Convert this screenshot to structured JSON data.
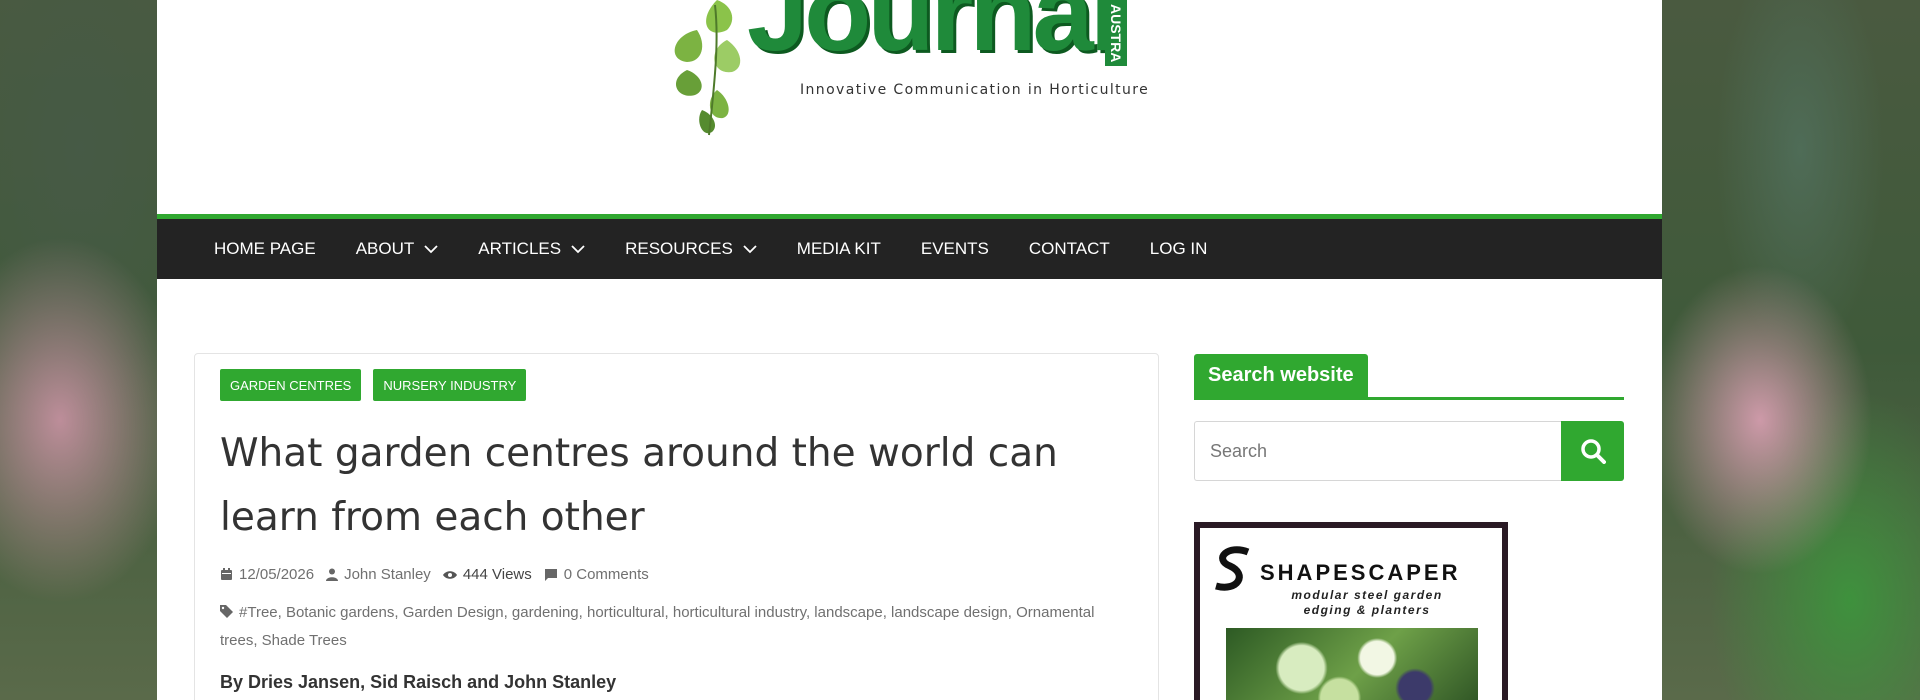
{
  "logo": {
    "word": "Journal",
    "badge": "AUSTRA",
    "tagline": "Innovative Communication in Horticulture"
  },
  "nav": {
    "items": [
      {
        "label": "HOME PAGE",
        "dropdown": false
      },
      {
        "label": "ABOUT",
        "dropdown": true
      },
      {
        "label": "ARTICLES",
        "dropdown": true
      },
      {
        "label": "RESOURCES",
        "dropdown": true
      },
      {
        "label": "MEDIA KIT",
        "dropdown": false
      },
      {
        "label": "EVENTS",
        "dropdown": false
      },
      {
        "label": "CONTACT",
        "dropdown": false
      },
      {
        "label": "LOG IN",
        "dropdown": false
      }
    ]
  },
  "article": {
    "categories": [
      "GARDEN CENTRES",
      "NURSERY INDUSTRY"
    ],
    "title": "What garden centres around the world can learn from each other",
    "date": "12/05/2026",
    "author": "John Stanley",
    "views": "444 Views",
    "comments": "0 Comments",
    "tags": "#Tree, Botanic gardens, Garden Design, gardening, horticultural, horticultural industry, landscape, landscape design, Ornamental trees, Shade Trees",
    "byline": "By Dries Jansen, Sid Raisch and John Stanley"
  },
  "sidebar": {
    "search_title": "Search website",
    "search_placeholder": "Search",
    "ad": {
      "brand": "SHAPESCAPER",
      "line1": "modular steel garden",
      "line2": "edging & planters"
    }
  },
  "colors": {
    "accent": "#30a830",
    "nav_bg": "#232323",
    "logo_green": "#1f8a3a"
  }
}
